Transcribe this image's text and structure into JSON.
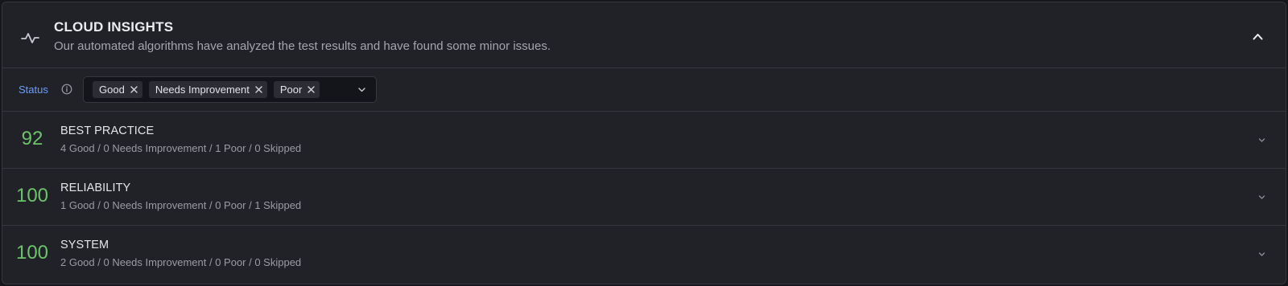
{
  "header": {
    "title": "CLOUD INSIGHTS",
    "subtitle": "Our automated algorithms have analyzed the test results and have found some minor issues.",
    "icon": "activity-icon",
    "collapse_icon": "chevron-up-icon"
  },
  "filter": {
    "label": "Status",
    "info_icon": "info-icon",
    "chips": [
      "Good",
      "Needs Improvement",
      "Poor"
    ],
    "remove_icon": "close-icon",
    "dropdown_icon": "chevron-down-icon"
  },
  "categories": [
    {
      "score": "92",
      "title": "BEST PRACTICE",
      "summary": "4 Good / 0 Needs Improvement / 1 Poor / 0 Skipped"
    },
    {
      "score": "100",
      "title": "RELIABILITY",
      "summary": "1 Good / 0 Needs Improvement / 0 Poor / 1 Skipped"
    },
    {
      "score": "100",
      "title": "SYSTEM",
      "summary": "2 Good / 0 Needs Improvement / 0 Poor / 0 Skipped"
    }
  ],
  "colors": {
    "background": "#212228",
    "accent_link": "#6e9cf5",
    "score_good": "#6cc46a",
    "chip_bg": "#2c2d34"
  }
}
